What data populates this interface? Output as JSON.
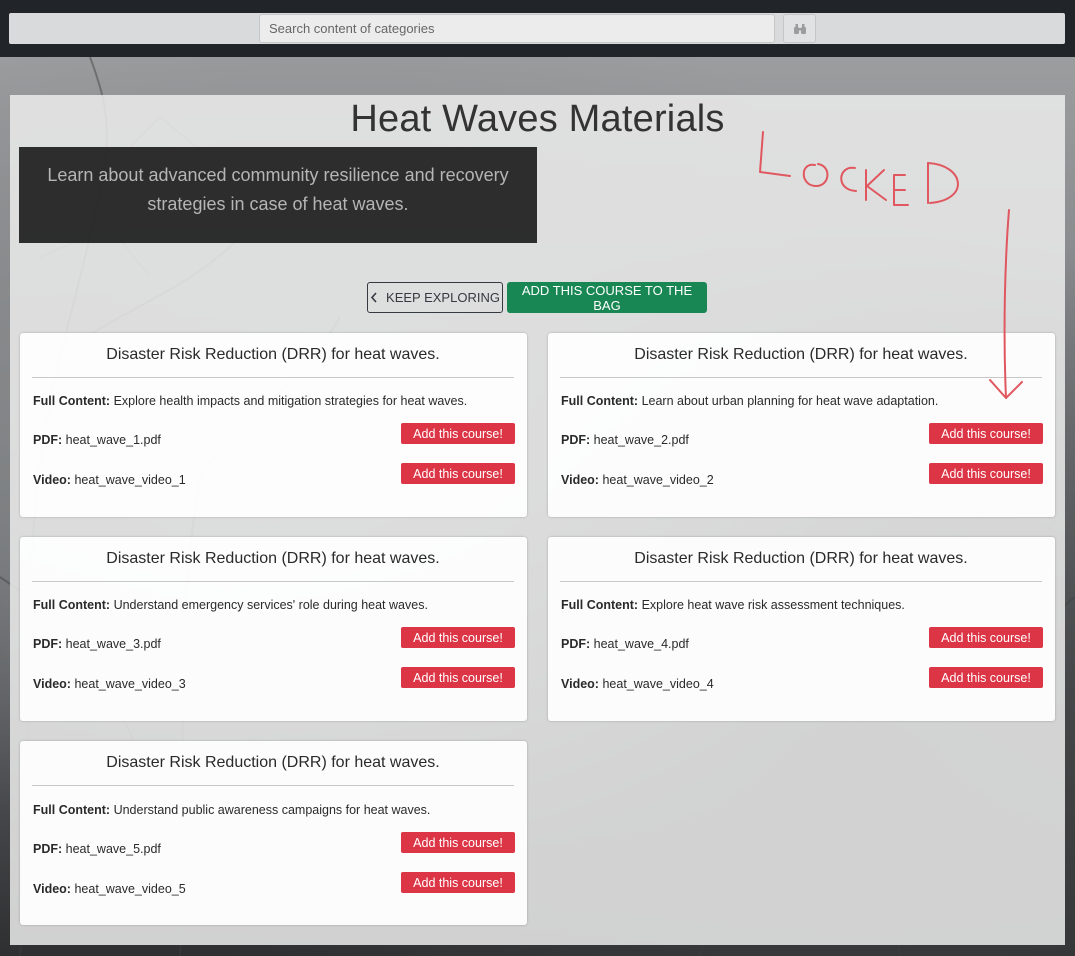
{
  "search": {
    "placeholder": "Search content of categories",
    "button_icon": "binoculars-icon"
  },
  "page": {
    "title": "Heat Waves Materials",
    "intro": "Learn about advanced community resilience and recovery strategies in case of heat waves."
  },
  "actions": {
    "explore_label": "KEEP EXPLORING",
    "add_bag_label": "ADD THIS COURSE TO THE BAG"
  },
  "labels": {
    "full_content": "Full Content:",
    "pdf": "PDF:",
    "video": "Video:",
    "add_course": "Add this course!"
  },
  "courses": [
    {
      "title": "Disaster Risk Reduction (DRR) for heat waves.",
      "full_content": "Explore health impacts and mitigation strategies for heat waves.",
      "pdf": "heat_wave_1.pdf",
      "video": "heat_wave_video_1"
    },
    {
      "title": "Disaster Risk Reduction (DRR) for heat waves.",
      "full_content": "Learn about urban planning for heat wave adaptation.",
      "pdf": "heat_wave_2.pdf",
      "video": "heat_wave_video_2"
    },
    {
      "title": "Disaster Risk Reduction (DRR) for heat waves.",
      "full_content": "Understand emergency services' role during heat waves.",
      "pdf": "heat_wave_3.pdf",
      "video": "heat_wave_video_3"
    },
    {
      "title": "Disaster Risk Reduction (DRR) for heat waves.",
      "full_content": "Explore heat wave risk assessment techniques.",
      "pdf": "heat_wave_4.pdf",
      "video": "heat_wave_video_4"
    },
    {
      "title": "Disaster Risk Reduction (DRR) for heat waves.",
      "full_content": "Understand public awareness campaigns for heat waves.",
      "pdf": "heat_wave_5.pdf",
      "video": "heat_wave_video_5"
    }
  ],
  "annotation": {
    "text": "LOCKED",
    "color": "#e0575f"
  },
  "colors": {
    "topbar": "#212529",
    "success": "#198754",
    "danger": "#dc3545"
  }
}
